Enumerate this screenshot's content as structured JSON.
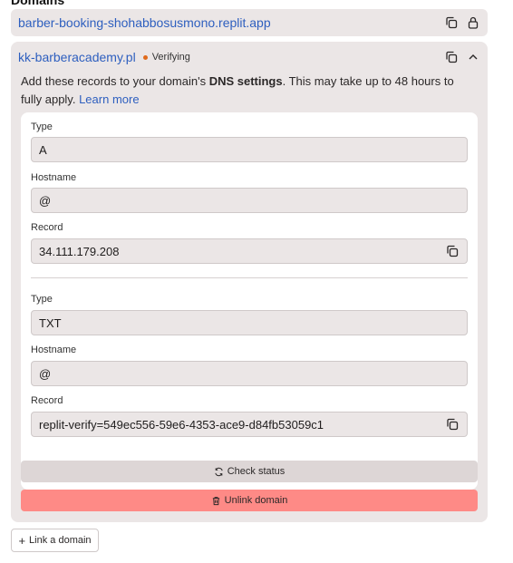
{
  "section": {
    "title": "Domains"
  },
  "replit_domain": {
    "url": "barber-booking-shohabbosusmono.replit.app"
  },
  "custom_domain": {
    "name": "kk-barberacademy.pl",
    "status": "Verifying",
    "description_prefix": "Add these records to your domain's ",
    "description_bold": "DNS settings",
    "description_suffix": ". This may take up to 48 hours to fully apply. ",
    "learn_more": "Learn more"
  },
  "records": [
    {
      "type_label": "Type",
      "type": "A",
      "hostname_label": "Hostname",
      "hostname": "@",
      "record_label": "Record",
      "record": "34.111.179.208"
    },
    {
      "type_label": "Type",
      "type": "TXT",
      "hostname_label": "Hostname",
      "hostname": "@",
      "record_label": "Record",
      "record": "replit-verify=549ec556-59e6-4353-ace9-d84fb53059c1"
    }
  ],
  "buttons": {
    "check_status": "Check status",
    "unlink_domain": "Unlink domain",
    "link_domain": "Link a domain"
  },
  "colors": {
    "card_bg": "#ebe6e6",
    "link": "#2e5fbf",
    "status_dot": "#e06a1b",
    "danger": "#fe8a86"
  },
  "icons": [
    "copy-icon",
    "lock-icon",
    "chevron-up-icon",
    "refresh-icon",
    "trash-icon",
    "plus-icon"
  ]
}
